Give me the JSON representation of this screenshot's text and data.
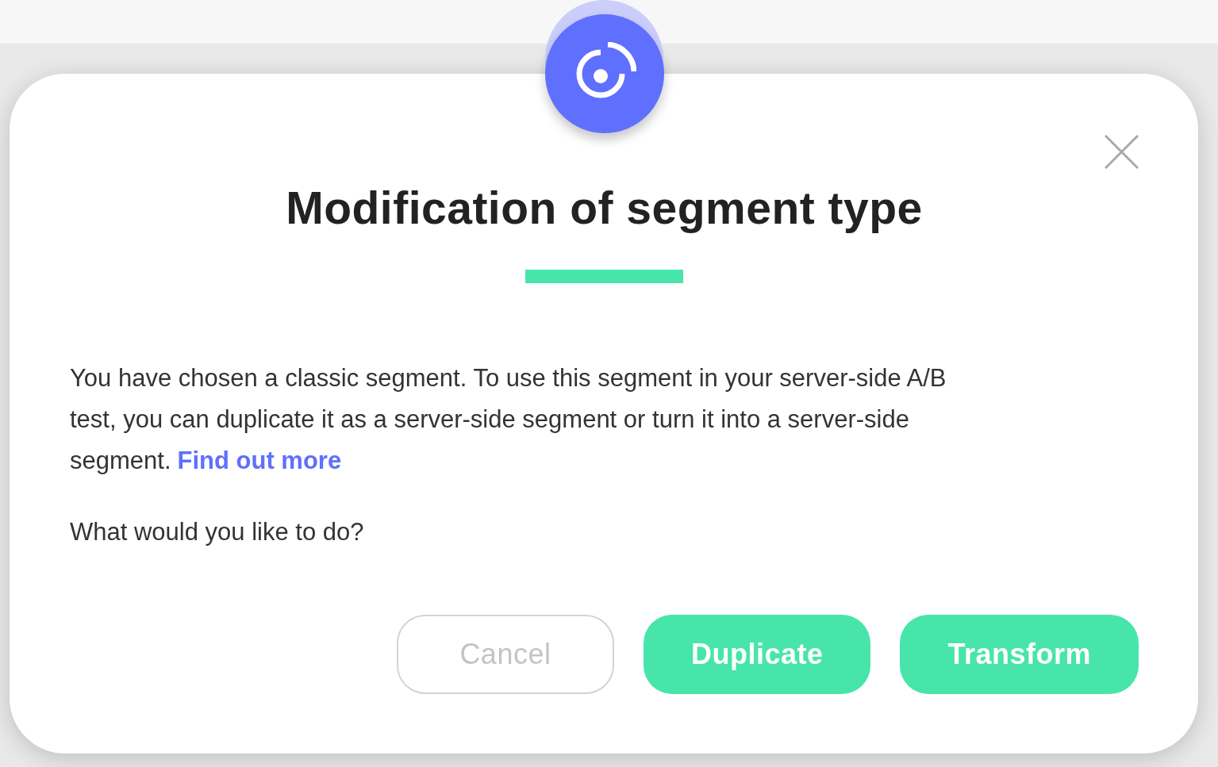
{
  "dialog": {
    "title": "Modification of segment type",
    "message": {
      "text": "You have chosen a classic segment. To use this segment in your server-side A/B test, you can duplicate it as a server-side segment or turn it into a server-side segment.",
      "link": "Find out more"
    },
    "question": "What would you like to do?",
    "buttons": [
      {
        "label": "Cancel",
        "kind": "secondary"
      },
      {
        "label": "Duplicate",
        "kind": "primary"
      },
      {
        "label": "Transform",
        "kind": "primary"
      }
    ]
  }
}
